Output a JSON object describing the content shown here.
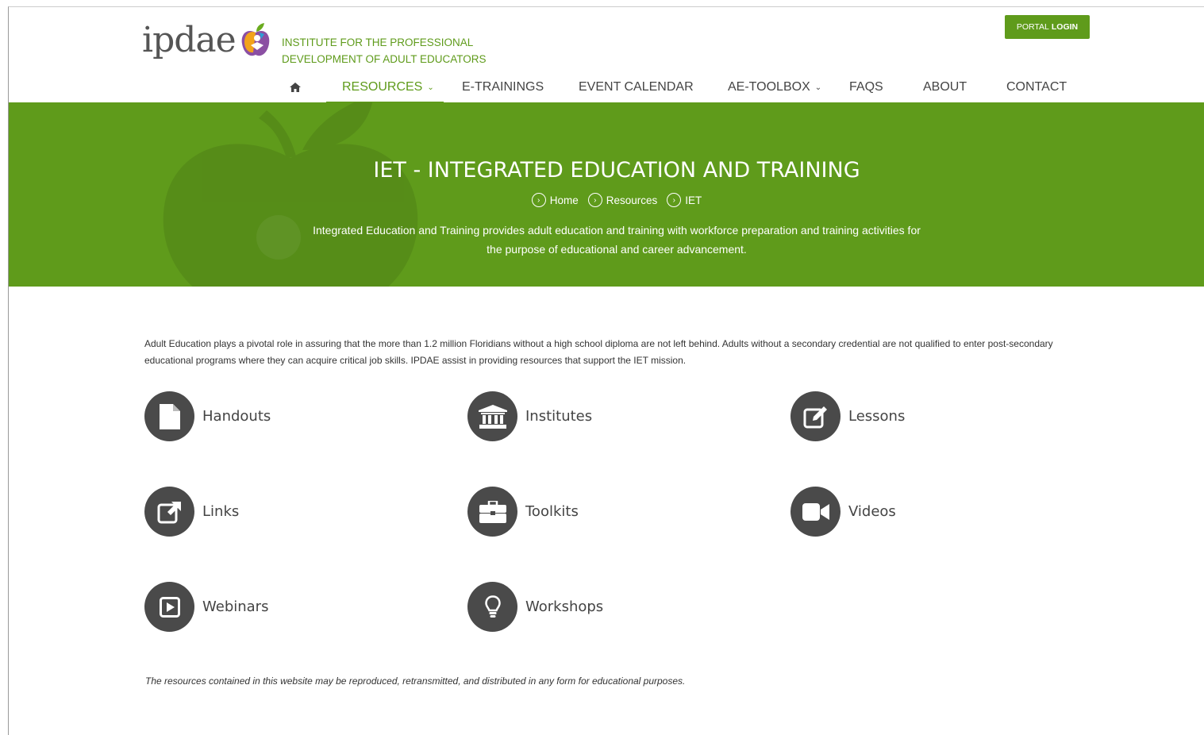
{
  "header": {
    "logo_text": "ipdae",
    "tagline_line1": "INSTITUTE FOR THE PROFESSIONAL",
    "tagline_line2": "DEVELOPMENT OF ADULT EDUCATORS",
    "portal_login_prefix": "PORTAL",
    "portal_login_bold": "LOGIN"
  },
  "nav": {
    "home_icon": "home-icon",
    "items": [
      {
        "label": "RESOURCES",
        "active": true,
        "dropdown": true
      },
      {
        "label": "E-TRAININGS"
      },
      {
        "label": "EVENT CALENDAR"
      },
      {
        "label": "AE-TOOLBOX",
        "dropdown": true
      },
      {
        "label": "FAQS"
      },
      {
        "label": "ABOUT"
      },
      {
        "label": "CONTACT"
      }
    ]
  },
  "hero": {
    "title": "IET - INTEGRATED EDUCATION AND TRAINING",
    "breadcrumb": [
      "Home",
      "Resources",
      "IET"
    ],
    "description": "Integrated Education and Training provides adult education and training with workforce preparation and training activities for the purpose of educational and career advancement."
  },
  "main": {
    "intro": "Adult Education plays a pivotal role in assuring that the more than 1.2 million Floridians without a high school diploma are not left behind. Adults without a secondary credential are not qualified to enter post-secondary educational programs where they can acquire critical job skills. IPDAE assist in providing resources that support the IET mission.",
    "resources": [
      {
        "label": "Handouts",
        "icon": "document-icon"
      },
      {
        "label": "Institutes",
        "icon": "institution-icon"
      },
      {
        "label": "Lessons",
        "icon": "edit-icon"
      },
      {
        "label": "Links",
        "icon": "external-link-icon"
      },
      {
        "label": "Toolkits",
        "icon": "briefcase-icon"
      },
      {
        "label": "Videos",
        "icon": "video-camera-icon"
      },
      {
        "label": "Webinars",
        "icon": "play-square-icon"
      },
      {
        "label": "Workshops",
        "icon": "lightbulb-icon"
      }
    ],
    "footer_note": "The resources contained in this website may be reproduced, retransmitted, and distributed in any form for educational purposes."
  },
  "colors": {
    "brand_green": "#5f9b1b",
    "icon_circle": "#4a4a4a"
  }
}
